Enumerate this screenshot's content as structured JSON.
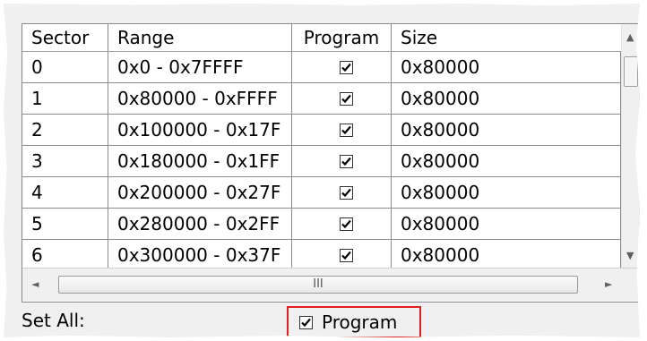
{
  "table": {
    "columns": [
      "Sector",
      "Range",
      "Program",
      "Size"
    ],
    "rows": [
      {
        "sector": "0",
        "range": "0x0 - 0x7FFFF",
        "program": true,
        "size": "0x80000"
      },
      {
        "sector": "1",
        "range": "0x80000 - 0xFFFF",
        "program": true,
        "size": "0x80000"
      },
      {
        "sector": "2",
        "range": "0x100000 - 0x17F",
        "program": true,
        "size": "0x80000"
      },
      {
        "sector": "3",
        "range": "0x180000 - 0x1FF",
        "program": true,
        "size": "0x80000"
      },
      {
        "sector": "4",
        "range": "0x200000 - 0x27F",
        "program": true,
        "size": "0x80000"
      },
      {
        "sector": "5",
        "range": "0x280000 - 0x2FF",
        "program": true,
        "size": "0x80000"
      },
      {
        "sector": "6",
        "range": "0x300000 - 0x37F",
        "program": true,
        "size": "0x80000"
      }
    ]
  },
  "scroll": {
    "up_glyph": "▲",
    "down_glyph": "▼",
    "left_glyph": "◄",
    "right_glyph": "►",
    "hgrip": "III"
  },
  "footer": {
    "set_all_label": "Set All:",
    "program_label": "Program",
    "program_checked": true
  },
  "colors": {
    "highlight": "#e0201e"
  }
}
